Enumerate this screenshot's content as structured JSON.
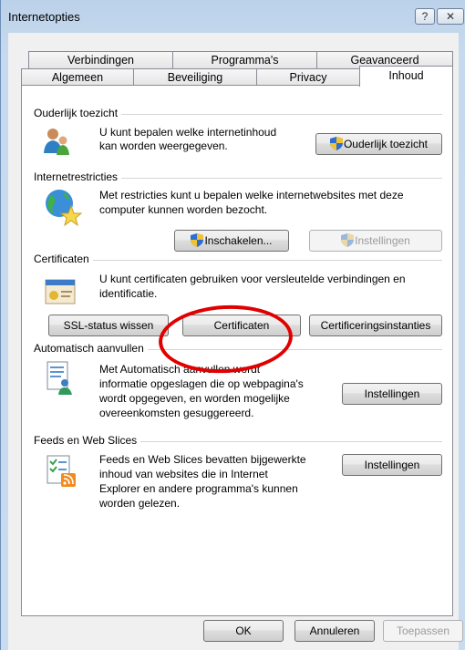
{
  "window": {
    "title": "Internetopties",
    "help_label": "?",
    "close_label": "✕"
  },
  "tabs": {
    "row1": [
      "Verbindingen",
      "Programma's",
      "Geavanceerd"
    ],
    "row2": [
      "Algemeen",
      "Beveiliging",
      "Privacy",
      "Inhoud"
    ],
    "active": "Inhoud"
  },
  "sections": {
    "parental": {
      "title": "Ouderlijk toezicht",
      "line1": "U kunt bepalen welke internetinhoud",
      "line2": "kan worden weergegeven.",
      "button": "Ouderlijk toezicht",
      "icon": "parental-control-icon"
    },
    "restrictions": {
      "title": "Internetrestricties",
      "line1": "Met restricties kunt u bepalen welke internetwebsites met deze",
      "line2": "computer kunnen worden bezocht.",
      "enable_button": "Inschakelen...",
      "settings_button": "Instellingen",
      "icon": "globe-star-icon"
    },
    "certificates": {
      "title": "Certificaten",
      "line1": "U kunt certificaten gebruiken voor versleutelde verbindingen en",
      "line2": "identificatie.",
      "ssl_button": "SSL-status wissen",
      "certs_button": "Certificaten",
      "authorities_button": "Certificeringsinstanties",
      "icon": "certificate-icon"
    },
    "autocomplete": {
      "title": "Automatisch aanvullen",
      "line1": "Met Automatisch aanvullen wordt",
      "line2": "informatie opgeslagen die op webpagina's",
      "line3": "wordt opgegeven, en worden mogelijke",
      "line4": "overeenkomsten gesuggereerd.",
      "button": "Instellingen",
      "icon": "autocomplete-icon"
    },
    "feeds": {
      "title": "Feeds en Web Slices",
      "line1": "Feeds en Web Slices bevatten bijgewerkte",
      "line2": "inhoud van websites die in Internet",
      "line3": "Explorer en andere programma's kunnen",
      "line4": "worden gelezen.",
      "button": "Instellingen",
      "icon": "feeds-icon"
    }
  },
  "footer": {
    "ok": "OK",
    "cancel": "Annuleren",
    "apply": "Toepassen"
  },
  "colors": {
    "annotation": "#e00000",
    "window_frame": "#c7d9ee"
  }
}
